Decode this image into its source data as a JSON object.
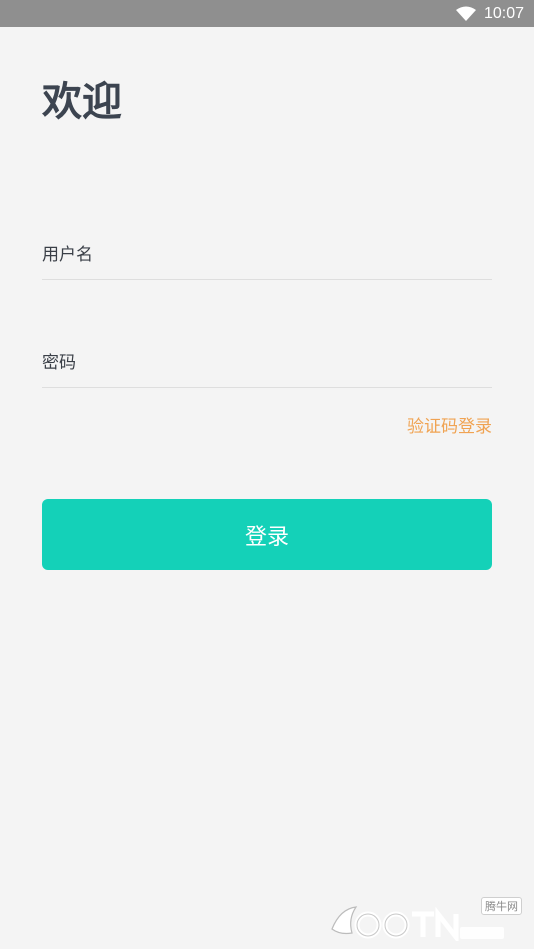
{
  "status_bar": {
    "time": "10:07",
    "icons": [
      "wifi-icon"
    ]
  },
  "header": {
    "title": "欢迎"
  },
  "form": {
    "username_placeholder": "用户名",
    "password_placeholder": "密码",
    "sms_login_link": "验证码登录",
    "login_button": "登录"
  },
  "watermark": {
    "label": "腾牛网",
    "brand": "QQTN.com"
  },
  "colors": {
    "status_bar": "#8f8f8f",
    "background": "#f4f4f4",
    "title": "#3c4450",
    "link": "#f0a352",
    "primary_button": "#14d1b8"
  }
}
